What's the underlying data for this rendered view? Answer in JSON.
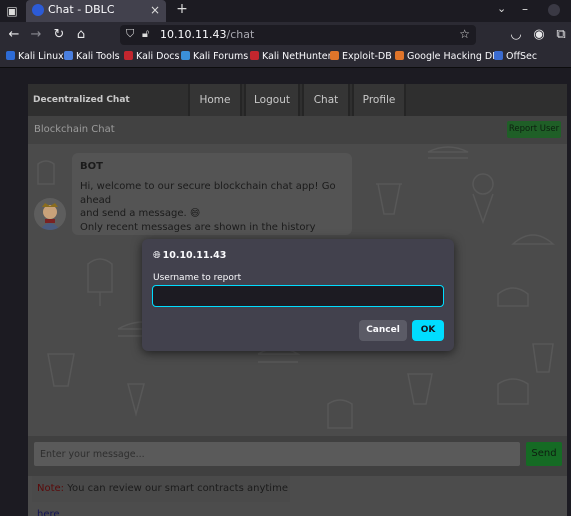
{
  "browser": {
    "tab_title": "Chat - DBLC",
    "tab_close": "×",
    "new_tab": "+",
    "url_host": "10.10.11.43",
    "url_path": "/chat"
  },
  "bookmarks": [
    {
      "label": "Kali Linux",
      "color": "#2d6bd6"
    },
    {
      "label": "Kali Tools",
      "color": "#4a7fe0"
    },
    {
      "label": "Kali Docs",
      "color": "#c4262e"
    },
    {
      "label": "Kali Forums",
      "color": "#3b8fd8"
    },
    {
      "label": "Kali NetHunter",
      "color": "#c4262e"
    },
    {
      "label": "Exploit-DB",
      "color": "#e0752a"
    },
    {
      "label": "Google Hacking DB",
      "color": "#e0752a"
    },
    {
      "label": "OffSec",
      "color": "#3a6bd0"
    }
  ],
  "app": {
    "brand": "Decentralized Chat",
    "nav": [
      "Home",
      "Logout",
      "Chat",
      "Profile"
    ],
    "section_title": "Blockchain Chat",
    "report_button": "Report User",
    "message": {
      "sender": "BOT",
      "line1": "Hi, welcome to our secure blockchain chat app! Go ahead",
      "line2": "and send a message. 😄",
      "line3": "Only recent messages are shown in the history"
    },
    "input_placeholder": "Enter your message...",
    "send_button": "Send",
    "note_label": "Note:",
    "note_text": " You can review our smart contracts anytime ",
    "note_link": "here"
  },
  "dialog": {
    "host": "10.10.11.43",
    "label": "Username to report",
    "input_value": "",
    "cancel": "Cancel",
    "ok": "OK"
  }
}
